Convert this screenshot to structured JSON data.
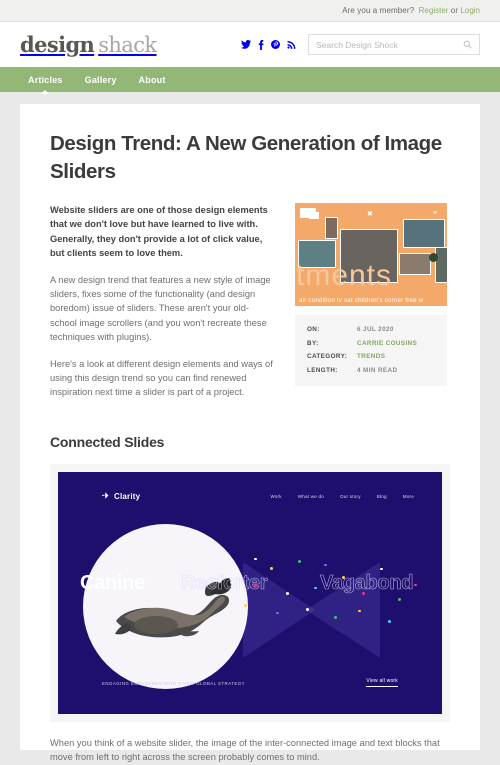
{
  "topbar": {
    "prompt": "Are you a member?",
    "register": "Register",
    "separator": "or",
    "login": "Login"
  },
  "brand": {
    "word1": "design",
    "word2": "shack"
  },
  "socials": [
    {
      "name": "twitter-icon"
    },
    {
      "name": "facebook-icon"
    },
    {
      "name": "pinterest-icon"
    },
    {
      "name": "rss-icon"
    }
  ],
  "search": {
    "placeholder": "Search Design Shock",
    "value": ""
  },
  "nav": {
    "items": [
      {
        "label": "Articles",
        "active": true
      },
      {
        "label": "Gallery",
        "active": false
      },
      {
        "label": "About",
        "active": false
      }
    ]
  },
  "article": {
    "title": "Design Trend: A New Generation of Image Sliders",
    "lead": "Website sliders are one of those design elements that we don't love but have learned to live with. Generally, they don't provide a lot of click value, but clients seem to love them.",
    "paragraphs": [
      "A new design trend that features a new style of image sliders, fixes some of the functionality (and design boredom) issue of sliders. These aren't your old-school image scrollers (and you won't recreate these techniques with plugins).",
      "Here's a look at different design elements and ways of using this design trend so you can find renewed inspiration next time a slider is part of a project."
    ],
    "closing": "When you think of a website slider, the image of the inter-connected image and text blocks that move from left to right across the screen probably comes to mind."
  },
  "hero": {
    "bigword": "rtments",
    "caption": "air condition  tv sat  children's corner  free w",
    "accent": "#f4a96a"
  },
  "meta": {
    "rows": [
      {
        "key": "ON:",
        "value": "6 JUL 2020",
        "green": false
      },
      {
        "key": "BY:",
        "value": "CARRIE COUSINS",
        "green": true
      },
      {
        "key": "CATEGORY:",
        "value": "TRENDS",
        "green": true
      },
      {
        "key": "LENGTH:",
        "value": "4 MIN READ",
        "green": false
      }
    ]
  },
  "section": {
    "heading": "Connected Slides"
  },
  "slider": {
    "logo": "Clarity",
    "nav": [
      {
        "label": "Work"
      },
      {
        "label": "What we do"
      },
      {
        "label": "Our story"
      },
      {
        "label": "Blog"
      },
      {
        "label": "More"
      }
    ],
    "slide_words": {
      "current": "Canine",
      "next": "Reeforter",
      "after": "Vagabond"
    },
    "caption": "ENGAGING EMPLOYEES WITH A NEW GLOBAL STRATEGY",
    "cta": "View all work",
    "bg": "#1e0f6e"
  },
  "colors": {
    "nav_green": "#93b776",
    "link_green": "#8aae69",
    "meta_green": "#7fa65c",
    "page_bg": "#e9e9e9",
    "slider_purple": "#1e0f6e"
  }
}
